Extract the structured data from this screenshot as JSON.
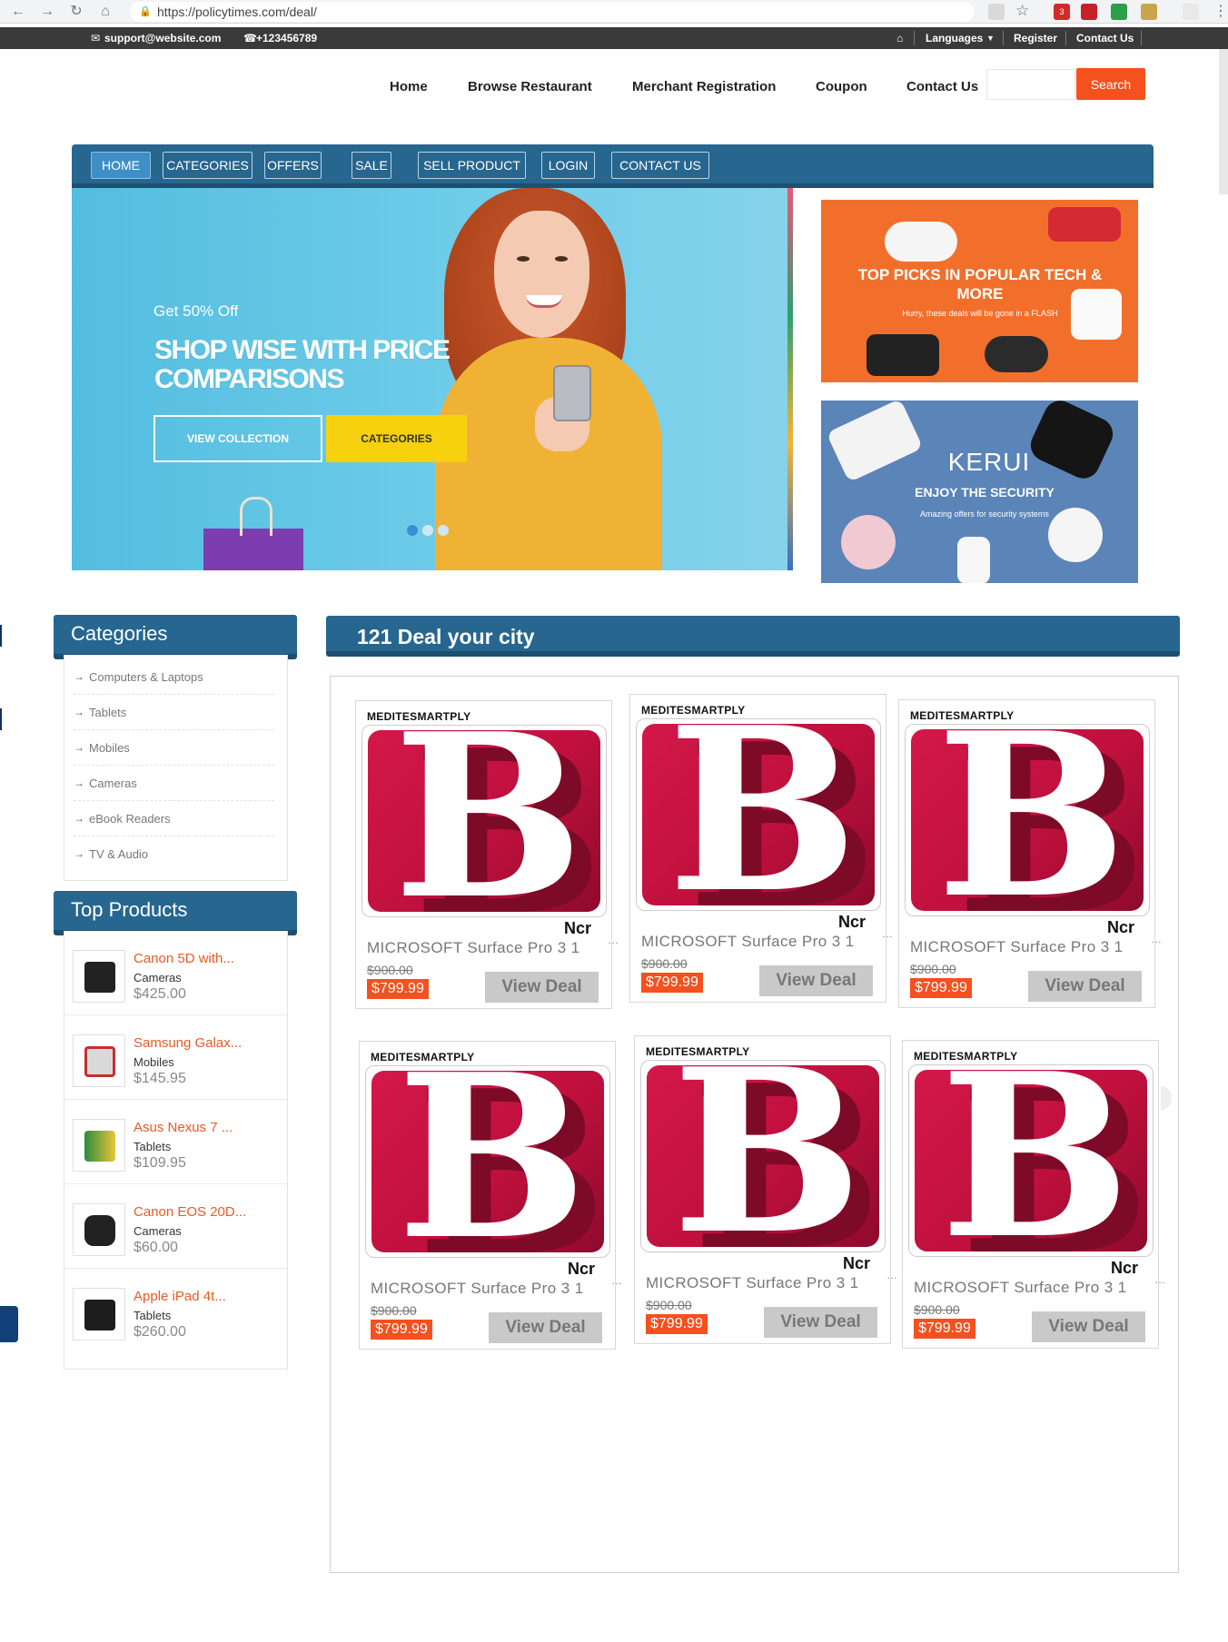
{
  "browser": {
    "url": "https://policytimes.com/deal/",
    "ext_badge": "3"
  },
  "topbar": {
    "email": "support@website.com",
    "phone": "+123456789",
    "languages": "Languages",
    "register": "Register",
    "contact": "Contact Us"
  },
  "mainnav": {
    "home": "Home",
    "browse": "Browse Restaurant",
    "merchant": "Merchant Registration",
    "coupon": "Coupon",
    "contact": "Contact Us",
    "search_button": "Search",
    "search_placeholder": ""
  },
  "navbar": {
    "items": [
      {
        "label": "HOME"
      },
      {
        "label": "CATEGORIES"
      },
      {
        "label": "OFFERS"
      },
      {
        "label": "SALE"
      },
      {
        "label": "SELL PRODUCT"
      },
      {
        "label": "LOGIN"
      },
      {
        "label": "CONTACT US"
      }
    ]
  },
  "hero": {
    "small": "Get 50% Off",
    "title": "SHOP WISE WITH PRICE COMPARISONS",
    "btn_view": "VIEW COLLECTION",
    "btn_categories": "CATEGORIES"
  },
  "banners": {
    "b1_title": "TOP PICKS IN POPULAR TECH & MORE",
    "b1_sub": "Hurry, these deals will be gone in a FLASH",
    "b2_brand": "KERUI",
    "b2_title": "ENJOY THE SECURITY",
    "b2_sub": "Amazing offers for security systems"
  },
  "categories": {
    "title": "Categories",
    "items": [
      "Computers & Laptops",
      "Tablets",
      "Mobiles",
      "Cameras",
      "eBook Readers",
      "TV & Audio"
    ]
  },
  "top_products": {
    "title": "Top Products",
    "items": [
      {
        "name": "Canon 5D with...",
        "cat": "Cameras",
        "price": "$425.00"
      },
      {
        "name": "Samsung Galax...",
        "cat": "Mobiles",
        "price": "$145.95"
      },
      {
        "name": "Asus Nexus 7 ...",
        "cat": "Tablets",
        "price": "$109.95"
      },
      {
        "name": "Canon EOS 20D...",
        "cat": "Cameras",
        "price": "$60.00"
      },
      {
        "name": "Apple iPad 4t...",
        "cat": "Tablets",
        "price": "$260.00"
      }
    ]
  },
  "deals": {
    "title": "121 Deal your city",
    "cards": [
      {
        "merchant": "MEDITESMARTPLY",
        "city": "Ncr",
        "title": "MICROSOFT Surface Pro 3 1",
        "old": "$900.00",
        "new": "$799.99",
        "btn": "View Deal"
      },
      {
        "merchant": "MEDITESMARTPLY",
        "city": "Ncr",
        "title": "MICROSOFT Surface Pro 3 1",
        "old": "$900.00",
        "new": "$799.99",
        "btn": "View Deal"
      },
      {
        "merchant": "MEDITESMARTPLY",
        "city": "Ncr",
        "title": "MICROSOFT Surface Pro 3 1",
        "old": "$900.00",
        "new": "$799.99",
        "btn": "View Deal"
      },
      {
        "merchant": "MEDITESMARTPLY",
        "city": "Ncr",
        "title": "MICROSOFT Surface Pro 3 1",
        "old": "$900.00",
        "new": "$799.99",
        "btn": "View Deal"
      },
      {
        "merchant": "MEDITESMARTPLY",
        "city": "Ncr",
        "title": "MICROSOFT Surface Pro 3 1",
        "old": "$900.00",
        "new": "$799.99",
        "btn": "View Deal"
      },
      {
        "merchant": "MEDITESMARTPLY",
        "city": "Ncr",
        "title": "MICROSOFT Surface Pro 3 1",
        "old": "$900.00",
        "new": "$799.99",
        "btn": "View Deal"
      }
    ],
    "logo_letter": "B"
  },
  "colors": {
    "nav_blue": "#27668f",
    "accent_orange": "#f4511e",
    "hero_yellow": "#f7d00e",
    "logo_red": "#c0103d"
  }
}
